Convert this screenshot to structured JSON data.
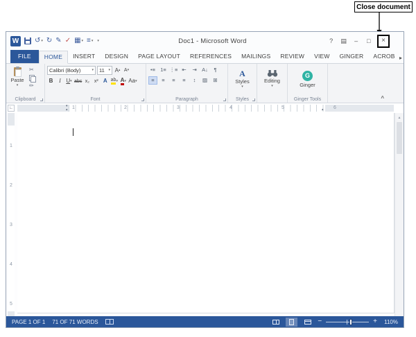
{
  "callout": {
    "label": "Close document"
  },
  "colors": {
    "accent": "#2b579a",
    "statusbar_bg": "#2b579a",
    "ginger_teal": "#2fb3a4",
    "highlight_yellow": "#ffe100",
    "font_color_red": "#c00000"
  },
  "titlebar": {
    "title": "Doc1 - Microsoft Word",
    "help": "?",
    "ribbon_options": "▤",
    "minimize": "–",
    "restore": "□",
    "close": "×"
  },
  "qat": {
    "logo": "W",
    "undo": "↺",
    "redo": "↻",
    "edit": "✎",
    "spelling": "✓",
    "table": "▦",
    "list": "≡"
  },
  "tabs": {
    "overflow": "▸",
    "items": [
      {
        "label": "FILE"
      },
      {
        "label": "HOME",
        "active": true
      },
      {
        "label": "INSERT"
      },
      {
        "label": "DESIGN"
      },
      {
        "label": "PAGE LAYOUT"
      },
      {
        "label": "REFERENCES"
      },
      {
        "label": "MAILINGS"
      },
      {
        "label": "REVIEW"
      },
      {
        "label": "VIEW"
      },
      {
        "label": "GINGER"
      },
      {
        "label": "ACROB"
      }
    ]
  },
  "ribbon": {
    "collapse": "^",
    "clipboard": {
      "label": "Clipboard",
      "paste": "Paste",
      "cut": "✂",
      "painter": "✏"
    },
    "font": {
      "label": "Font",
      "name": "Calibri (Body)",
      "size": "11",
      "grow": "A",
      "shrink": "A",
      "bold": "B",
      "italic": "I",
      "underline": "U",
      "strike": "abc",
      "subscript": "x₂",
      "superscript": "x²",
      "effects": "A",
      "highlight": "ab",
      "color": "A",
      "case": "Aa"
    },
    "paragraph": {
      "label": "Paragraph",
      "bullets": "•≡",
      "numbering": "1≡",
      "multilevel": "⋮≡",
      "outdent": "⇤",
      "indent": "⇥",
      "sort": "A↓",
      "pilcrow": "¶",
      "align_left": "≡",
      "align_center": "≡",
      "align_right": "≡",
      "justify": "≡",
      "line_spacing": "↕",
      "shading": "▨",
      "borders": "⊞"
    },
    "styles": {
      "label": "Styles",
      "button": "Styles",
      "icon": "A"
    },
    "editing": {
      "button": "Editing"
    },
    "ginger": {
      "label": "Ginger Tools",
      "button": "Ginger",
      "logo": "G"
    }
  },
  "ruler": {
    "tab_selector": "∟",
    "h_numbers": [
      "1",
      "2",
      "3",
      "4",
      "5",
      "6"
    ],
    "v_numbers": [
      "1",
      "2",
      "3",
      "4",
      "5"
    ]
  },
  "statusbar": {
    "page": "PAGE 1 OF 1",
    "words": "71 OF 71 WORDS",
    "zoom_out": "−",
    "zoom_in": "+",
    "zoom_level": "110%"
  },
  "ui": {
    "caret": "▾",
    "caret_up": "▴"
  }
}
